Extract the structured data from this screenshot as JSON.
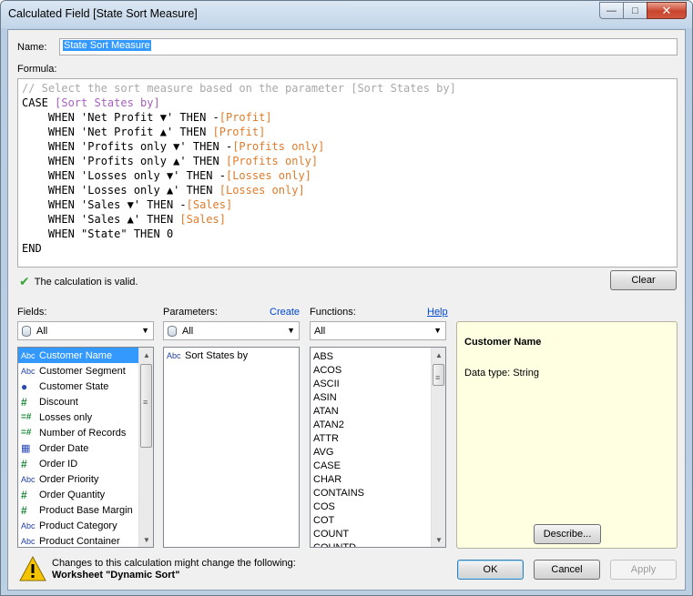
{
  "window": {
    "title": "Calculated Field [State Sort Measure]",
    "controls": {
      "minimize": "—",
      "maximize": "□",
      "close": "✕"
    }
  },
  "name_field": {
    "label": "Name:",
    "value": "State Sort Measure"
  },
  "formula": {
    "label": "Formula:",
    "lines": [
      [
        {
          "t": "// Select the sort measure based on the parameter [Sort States by]",
          "c": "comment"
        }
      ],
      [
        {
          "t": "CASE ",
          "c": "kw"
        },
        {
          "t": "[Sort States by]",
          "c": "param"
        }
      ],
      [
        {
          "t": "    WHEN 'Net Profit ▼' THEN -",
          "c": "kw"
        },
        {
          "t": "[Profit]",
          "c": "field"
        }
      ],
      [
        {
          "t": "    WHEN 'Net Profit ▲' THEN ",
          "c": "kw"
        },
        {
          "t": "[Profit]",
          "c": "field"
        }
      ],
      [
        {
          "t": "    WHEN 'Profits only ▼' THEN -",
          "c": "kw"
        },
        {
          "t": "[Profits only]",
          "c": "field"
        }
      ],
      [
        {
          "t": "    WHEN 'Profits only ▲' THEN ",
          "c": "kw"
        },
        {
          "t": "[Profits only]",
          "c": "field"
        }
      ],
      [
        {
          "t": "    WHEN 'Losses only ▼' THEN -",
          "c": "kw"
        },
        {
          "t": "[Losses only]",
          "c": "field"
        }
      ],
      [
        {
          "t": "    WHEN 'Losses only ▲' THEN ",
          "c": "kw"
        },
        {
          "t": "[Losses only]",
          "c": "field"
        }
      ],
      [
        {
          "t": "    WHEN 'Sales ▼' THEN -",
          "c": "kw"
        },
        {
          "t": "[Sales]",
          "c": "field"
        }
      ],
      [
        {
          "t": "    WHEN 'Sales ▲' THEN ",
          "c": "kw"
        },
        {
          "t": "[Sales]",
          "c": "field"
        }
      ],
      [
        {
          "t": "    WHEN \"State\" THEN 0",
          "c": "kw"
        }
      ],
      [
        {
          "t": "END",
          "c": "kw"
        }
      ]
    ]
  },
  "validation": {
    "text": "The calculation is valid.",
    "icon": "check-icon"
  },
  "clear_button": "Clear",
  "fields": {
    "label": "Fields:",
    "filter": "All",
    "items": [
      {
        "label": "Customer Name",
        "icon": "Abc",
        "type": "abc",
        "selected": true
      },
      {
        "label": "Customer Segment",
        "icon": "Abc",
        "type": "abc"
      },
      {
        "label": "Customer State",
        "icon": "●",
        "type": "globe"
      },
      {
        "label": "Discount",
        "icon": "#",
        "type": "hash"
      },
      {
        "label": "Losses only",
        "icon": "=#",
        "type": "calc"
      },
      {
        "label": "Number of Records",
        "icon": "=#",
        "type": "calc"
      },
      {
        "label": "Order Date",
        "icon": "▦",
        "type": "date"
      },
      {
        "label": "Order ID",
        "icon": "#",
        "type": "hash"
      },
      {
        "label": "Order Priority",
        "icon": "Abc",
        "type": "abc"
      },
      {
        "label": "Order Quantity",
        "icon": "#",
        "type": "hash"
      },
      {
        "label": "Product Base Margin",
        "icon": "#",
        "type": "hash"
      },
      {
        "label": "Product Category",
        "icon": "Abc",
        "type": "abc"
      },
      {
        "label": "Product Container",
        "icon": "Abc",
        "type": "abc"
      }
    ]
  },
  "parameters": {
    "label": "Parameters:",
    "create_link": "Create",
    "filter": "All",
    "items": [
      {
        "label": "Sort States by",
        "icon": "Abc"
      }
    ]
  },
  "functions": {
    "label": "Functions:",
    "help_link": "Help",
    "filter": "All",
    "items": [
      "ABS",
      "ACOS",
      "ASCII",
      "ASIN",
      "ATAN",
      "ATAN2",
      "ATTR",
      "AVG",
      "CASE",
      "CHAR",
      "CONTAINS",
      "COS",
      "COT",
      "COUNT",
      "COUNTD"
    ]
  },
  "info": {
    "title": "Customer Name",
    "data_type": "Data type: String",
    "describe_button": "Describe..."
  },
  "warning": {
    "line1": "Changes to this calculation might change the following:",
    "line2": "Worksheet \"Dynamic Sort\""
  },
  "buttons": {
    "ok": "OK",
    "cancel": "Cancel",
    "apply": "Apply"
  }
}
